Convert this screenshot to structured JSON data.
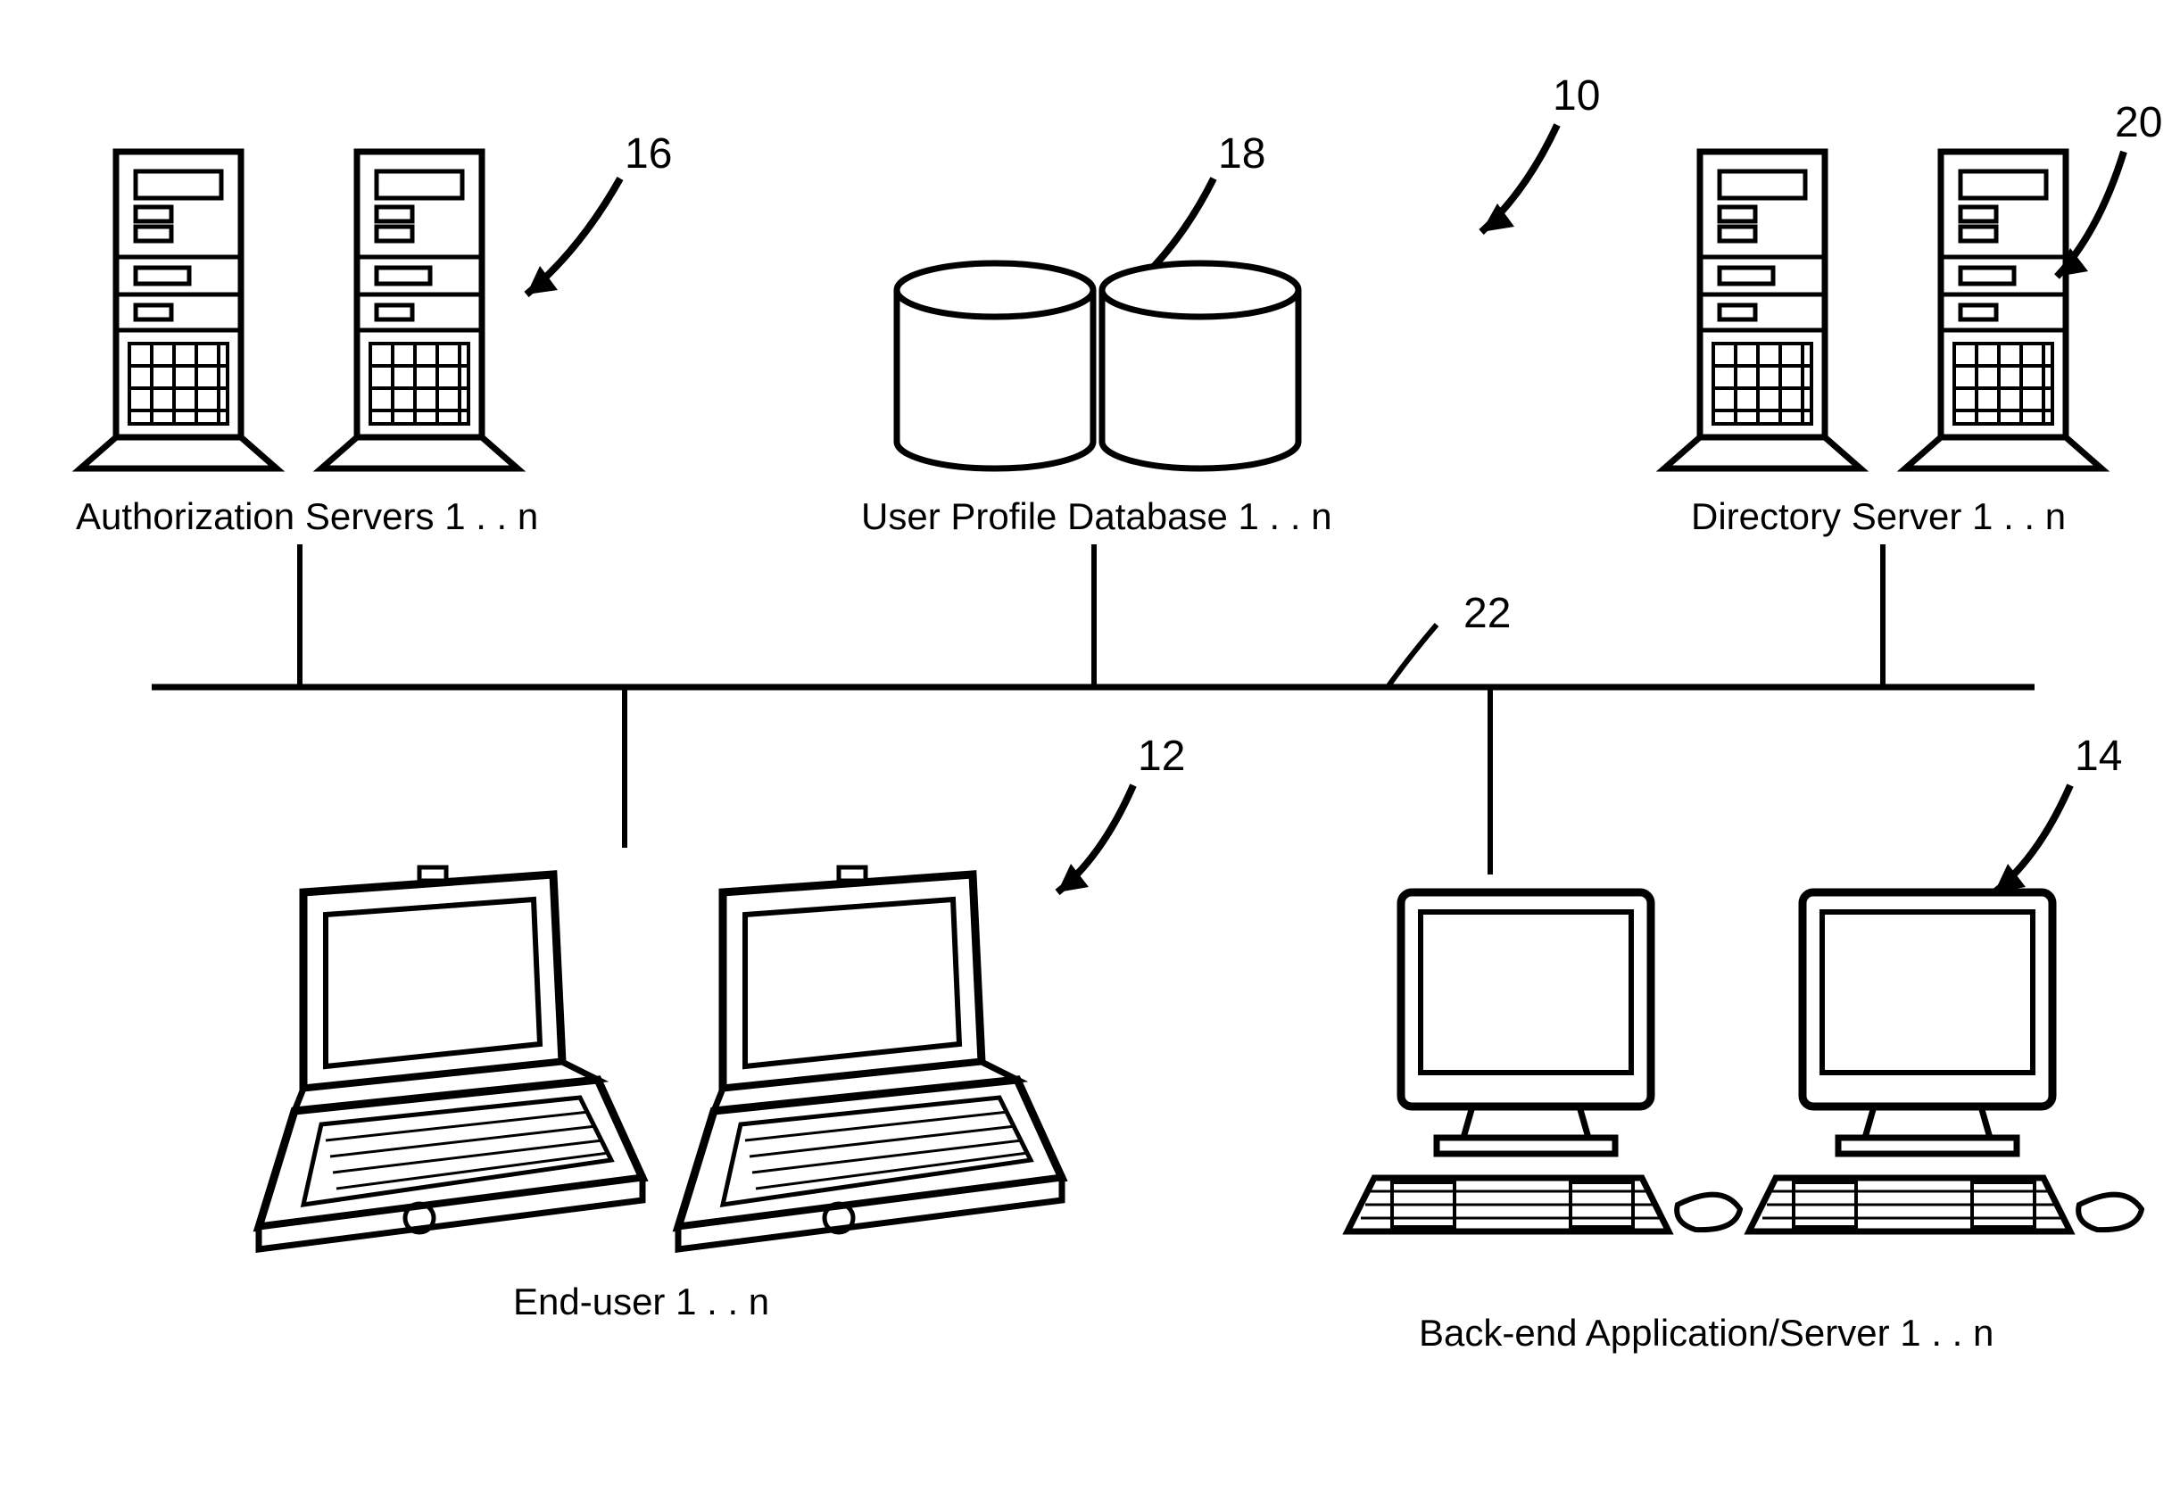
{
  "refs": {
    "r10": "10",
    "r12": "12",
    "r14": "14",
    "r16": "16",
    "r18": "18",
    "r20": "20",
    "r22": "22"
  },
  "labels": {
    "auth_servers": "Authorization Servers 1 . . n",
    "user_profile_db": "User Profile Database 1 . . n",
    "directory_server": "Directory Server 1 . . n",
    "end_user": "End-user 1 . . n",
    "backend": "Back-end Application/Server 1 . . n"
  }
}
